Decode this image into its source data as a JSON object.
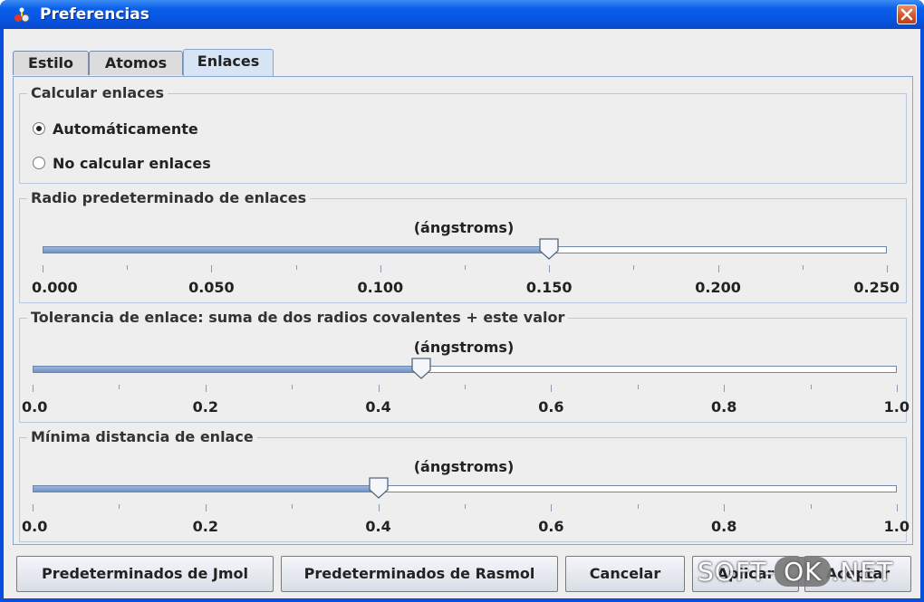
{
  "window": {
    "title": "Preferencias"
  },
  "tabs": [
    {
      "label": "Estilo",
      "active": false
    },
    {
      "label": "Atomos",
      "active": false
    },
    {
      "label": "Enlaces",
      "active": true
    }
  ],
  "calc_group": {
    "legend": "Calcular enlaces",
    "options": [
      {
        "label": "Automáticamente",
        "selected": true
      },
      {
        "label": "No calcular enlaces",
        "selected": false
      }
    ]
  },
  "radius_group": {
    "legend": "Radio predeterminado de enlaces",
    "units": "(ángstroms)",
    "value": 0.15,
    "min": 0.0,
    "max": 0.25,
    "tick_labels": [
      "0.000",
      "0.050",
      "0.100",
      "0.150",
      "0.200",
      "0.250"
    ]
  },
  "tolerance_group": {
    "legend": "Tolerancia de enlace: suma de dos radios covalentes + este valor",
    "units": "(ángstroms)",
    "value": 0.45,
    "min": 0.0,
    "max": 1.0,
    "tick_labels": [
      "0.0",
      "0.2",
      "0.4",
      "0.6",
      "0.8",
      "1.0"
    ]
  },
  "min_distance_group": {
    "legend": "Mínima distancia de enlace",
    "units": "(ángstroms)",
    "value": 0.4,
    "min": 0.0,
    "max": 1.0,
    "tick_labels": [
      "0.0",
      "0.2",
      "0.4",
      "0.6",
      "0.8",
      "1.0"
    ]
  },
  "buttons": {
    "jmol_defaults": "Predeterminados de Jmol",
    "rasmol_defaults": "Predeterminados de Rasmol",
    "cancel": "Cancelar",
    "apply": "Aplicar",
    "accept": "Aceptar"
  },
  "watermark": {
    "prefix": "SOFT-",
    "ok": "OK",
    "suffix": ".NET"
  },
  "colors": {
    "titlebar": "#0a5fe8",
    "close": "#d4502a",
    "panel": "#eeeeee",
    "accent": "#6f92c6"
  }
}
